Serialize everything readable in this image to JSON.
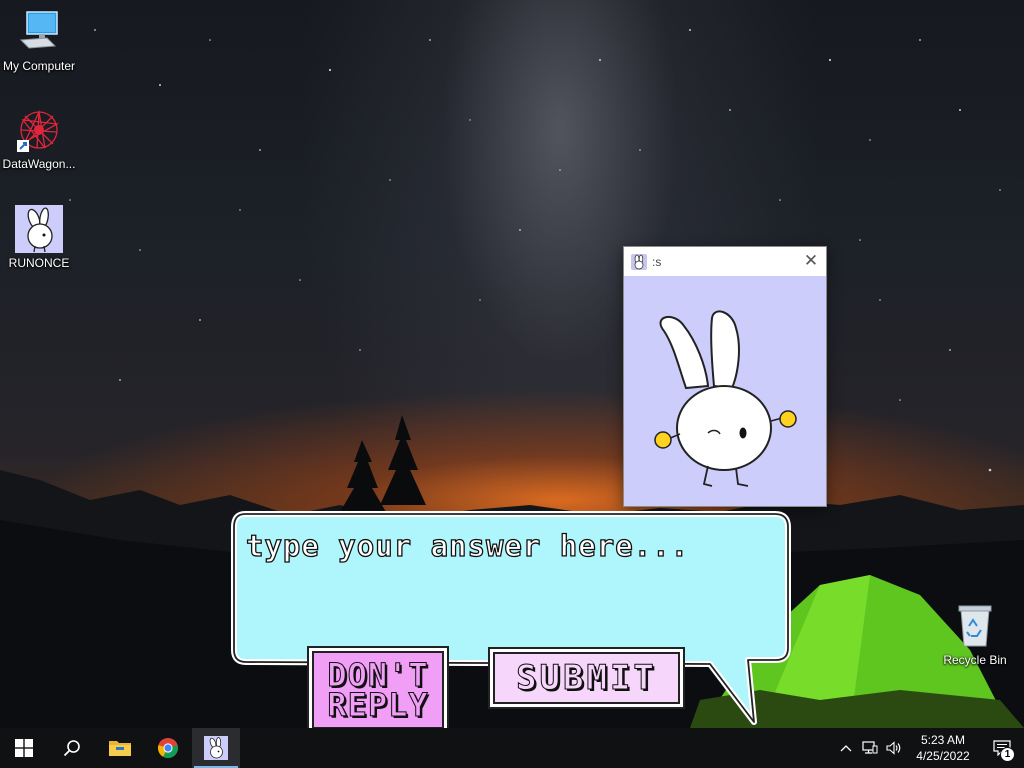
{
  "desktop": {
    "icons": [
      {
        "label": "My Computer",
        "icon": "monitor-icon"
      },
      {
        "label": "DataWagon...",
        "icon": "datawagon-shortcut-icon"
      },
      {
        "label": "RUNONCE",
        "icon": "bunny-app-icon"
      },
      {
        "label": "Recycle Bin",
        "icon": "recycle-bin-icon"
      }
    ]
  },
  "window": {
    "title": ":s",
    "close_glyph": "✕",
    "content": "bunny-character-image",
    "background_color": "#cccdfb"
  },
  "dialog": {
    "input_placeholder": "type your answer here...",
    "input_value": "",
    "dont_reply_label": "DON'T REPLY",
    "submit_label": "SUBMIT",
    "bubble_color": "#aef6fb",
    "dont_reply_color": "#f19ef6",
    "submit_color": "#f6d6fa"
  },
  "taskbar": {
    "start": "windows-logo-icon",
    "search": "search-icon",
    "pinned": [
      "file-explorer-icon",
      "chrome-icon",
      "bunny-app-icon"
    ],
    "active_app": "bunny-app-icon",
    "tray": {
      "icons": [
        "chevron-up-icon",
        "network-icon",
        "volume-icon"
      ],
      "time": "5:23 AM",
      "date": "4/25/2022",
      "notification_count": "1"
    }
  }
}
